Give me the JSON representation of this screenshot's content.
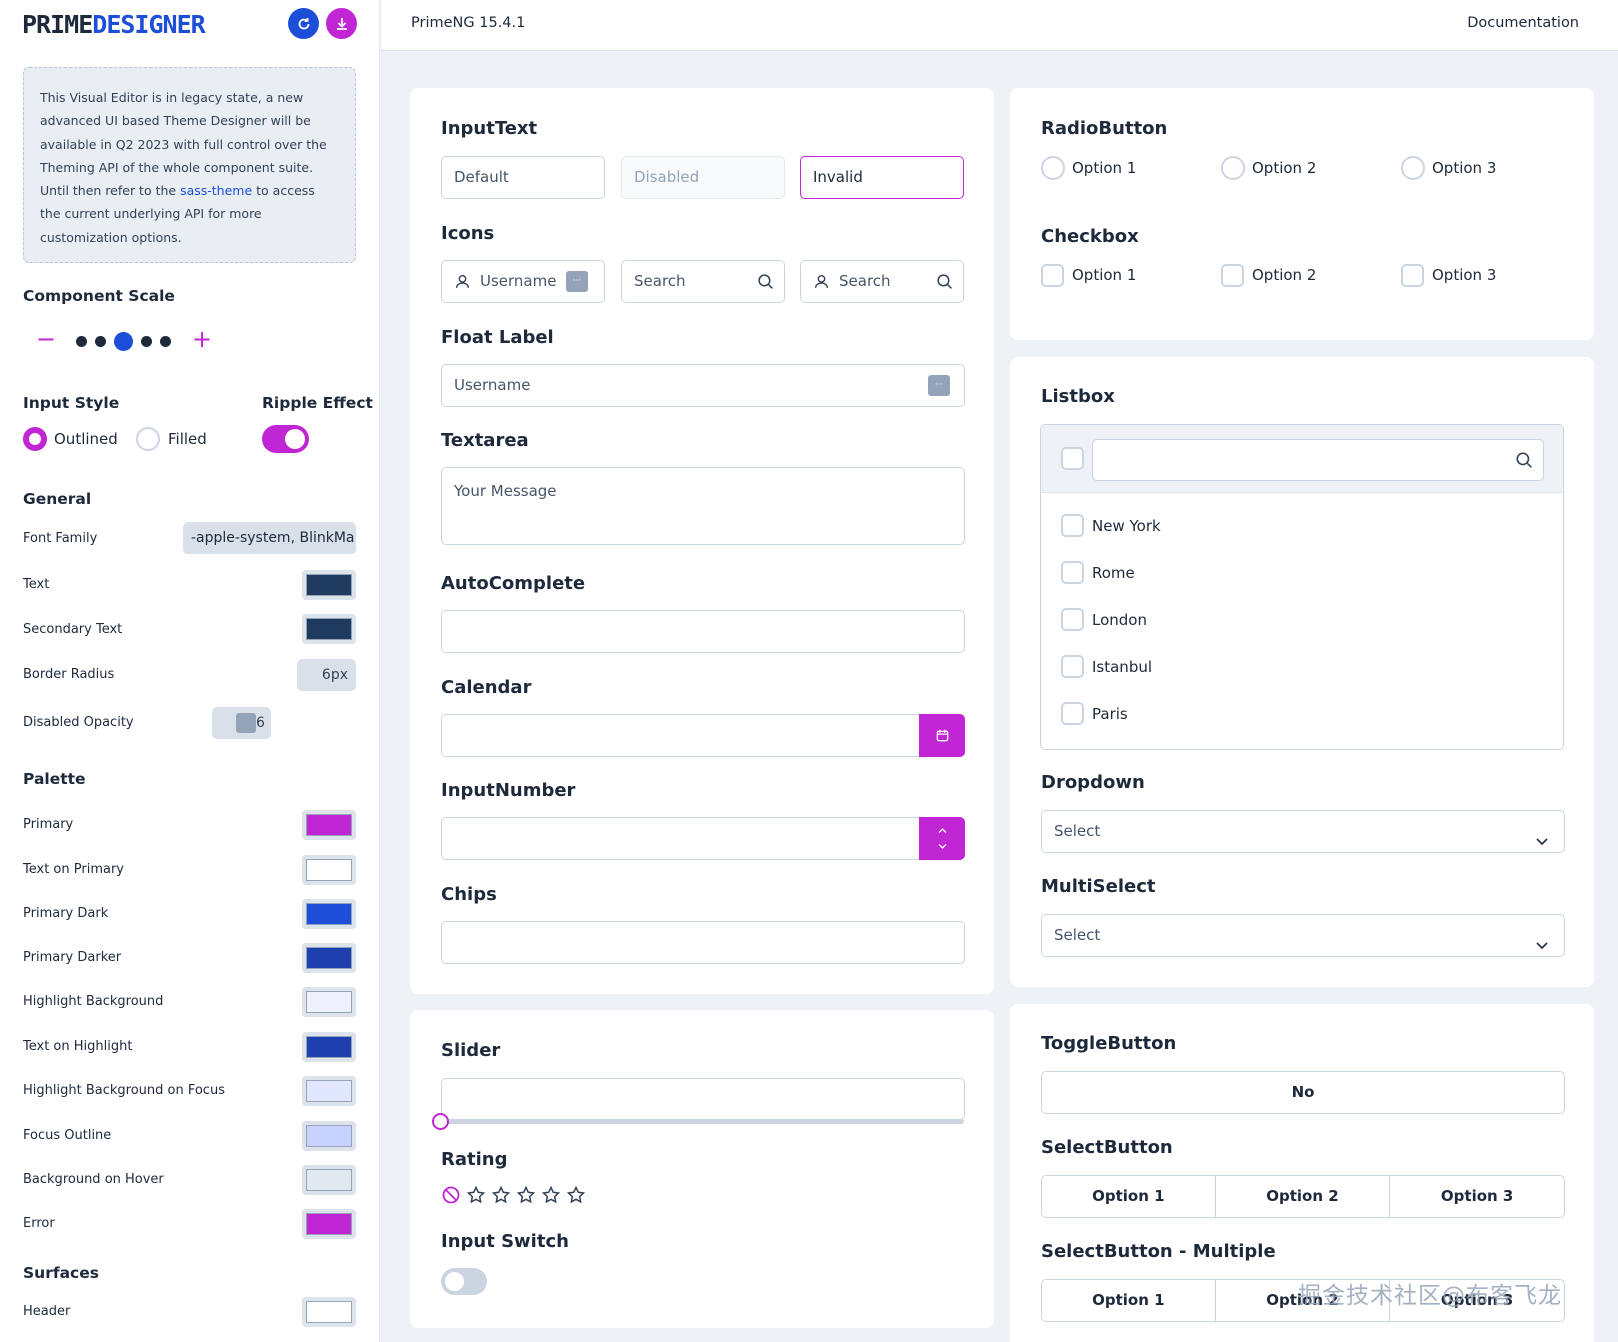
{
  "sidebar": {
    "logo_part1": "PRIME",
    "logo_part2": "DESIGNER",
    "notice_text_1": "This Visual Editor is in legacy state, a new advanced UI based Theme Designer will be available in Q2 2023 with full control over the Theming API of the whole component suite. Until then refer to the ",
    "notice_link": "sass-theme",
    "notice_text_2": " to access the current underlying API for more customization options.",
    "component_scale_title": "Component Scale",
    "input_style_title": "Input Style",
    "ripple_effect_title": "Ripple Effect",
    "outlined_label": "Outlined",
    "filled_label": "Filled",
    "general_title": "General",
    "font_family_label": "Font Family",
    "font_family_value": "-apple-system, BlinkMa",
    "text_label": "Text",
    "secondary_text_label": "Secondary Text",
    "border_radius_label": "Border Radius",
    "border_radius_value": "6px",
    "disabled_opacity_label": "Disabled Opacity",
    "disabled_opacity_value": "6",
    "palette_title": "Palette",
    "palette": [
      {
        "label": "Primary",
        "color": "#c026d3"
      },
      {
        "label": "Text on Primary",
        "color": "#ffffff"
      },
      {
        "label": "Primary Dark",
        "color": "#1d4ed8"
      },
      {
        "label": "Primary Darker",
        "color": "#1e40af"
      },
      {
        "label": "Highlight Background",
        "color": "#eef2ff"
      },
      {
        "label": "Text on Highlight",
        "color": "#1e40af"
      },
      {
        "label": "Highlight Background on Focus",
        "color": "#e0e7ff"
      },
      {
        "label": "Focus Outline",
        "color": "#c7d2fe"
      },
      {
        "label": "Background on Hover",
        "color": "#e2e8f0"
      },
      {
        "label": "Error",
        "color": "#c026d3"
      }
    ],
    "general_colors": {
      "text": "#1e3a5f",
      "secondary_text": "#1e3a5f"
    },
    "surfaces_title": "Surfaces",
    "header_label": "Header",
    "header_color": "#ffffff"
  },
  "header": {
    "version": "PrimeNG 15.4.1",
    "documentation": "Documentation"
  },
  "inputtext": {
    "title": "InputText",
    "default": "Default",
    "disabled": "Disabled",
    "invalid": "Invalid"
  },
  "icons": {
    "title": "Icons",
    "username": "Username",
    "search1": "Search",
    "search2": "Search"
  },
  "float_label": {
    "title": "Float Label",
    "username": "Username"
  },
  "textarea": {
    "title": "Textarea",
    "placeholder": "Your Message"
  },
  "autocomplete": {
    "title": "AutoComplete"
  },
  "calendar": {
    "title": "Calendar"
  },
  "inputnumber": {
    "title": "InputNumber"
  },
  "chips": {
    "title": "Chips"
  },
  "slider": {
    "title": "Slider",
    "value": 0
  },
  "rating": {
    "title": "Rating",
    "value": 0,
    "stars": 5
  },
  "input_switch": {
    "title": "Input Switch",
    "checked": false
  },
  "radiobutton": {
    "title": "RadioButton",
    "options": [
      "Option 1",
      "Option 2",
      "Option 3"
    ]
  },
  "checkbox": {
    "title": "Checkbox",
    "options": [
      "Option 1",
      "Option 2",
      "Option 3"
    ]
  },
  "listbox": {
    "title": "Listbox",
    "items": [
      "New York",
      "Rome",
      "London",
      "Istanbul",
      "Paris"
    ]
  },
  "dropdown": {
    "title": "Dropdown",
    "value": "Select"
  },
  "multiselect": {
    "title": "MultiSelect",
    "value": "Select"
  },
  "togglebutton": {
    "title": "ToggleButton",
    "label": "No"
  },
  "selectbutton": {
    "title": "SelectButton",
    "options": [
      "Option 1",
      "Option 2",
      "Option 3"
    ]
  },
  "selectbutton_multiple": {
    "title": "SelectButton - Multiple",
    "options": [
      "Option 1",
      "Option 2",
      "Option 3"
    ]
  },
  "watermark": "掘金技术社区@布客飞龙",
  "colors": {
    "primary": "#c026d3",
    "primary_dark": "#1d4ed8"
  }
}
